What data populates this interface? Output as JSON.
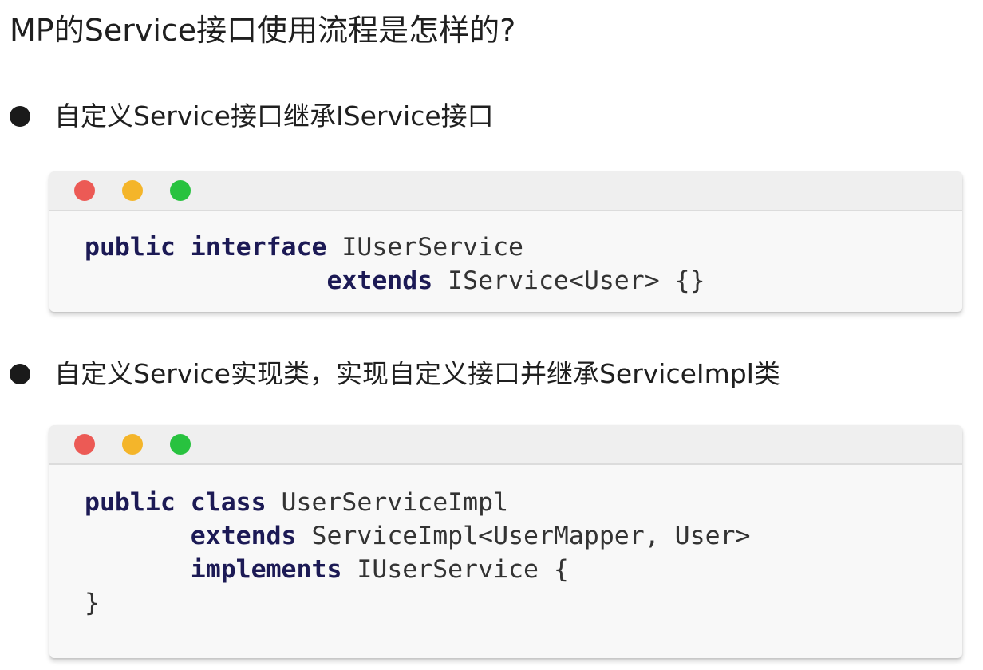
{
  "title": "MP的Service接口使用流程是怎样的?",
  "bullets": [
    {
      "text": "自定义Service接口继承IService接口",
      "code": {
        "lines": [
          [
            {
              "kw": "public"
            },
            {
              "t": " "
            },
            {
              "kw": "interface"
            },
            {
              "t": " IUserService"
            }
          ],
          [
            {
              "t": "                "
            },
            {
              "kw": "extends"
            },
            {
              "t": " IService<User> {}"
            }
          ]
        ]
      }
    },
    {
      "text": "自定义Service实现类，实现自定义接口并继承ServiceImpl类",
      "code": {
        "lines": [
          [
            {
              "kw": "public"
            },
            {
              "t": " "
            },
            {
              "kw": "class"
            },
            {
              "t": " UserServiceImpl"
            }
          ],
          [
            {
              "t": "       "
            },
            {
              "kw": "extends"
            },
            {
              "t": " ServiceImpl<UserMapper, User>"
            }
          ],
          [
            {
              "t": "       "
            },
            {
              "kw": "implements"
            },
            {
              "t": " IUserService {"
            }
          ],
          [
            {
              "t": "}"
            }
          ]
        ]
      }
    }
  ],
  "window_dot_colors": {
    "red": "#ec5a55",
    "yellow": "#f4b52a",
    "green": "#28c23f"
  },
  "keyword_color": "#1c1a55",
  "code_text_color": "#333333"
}
